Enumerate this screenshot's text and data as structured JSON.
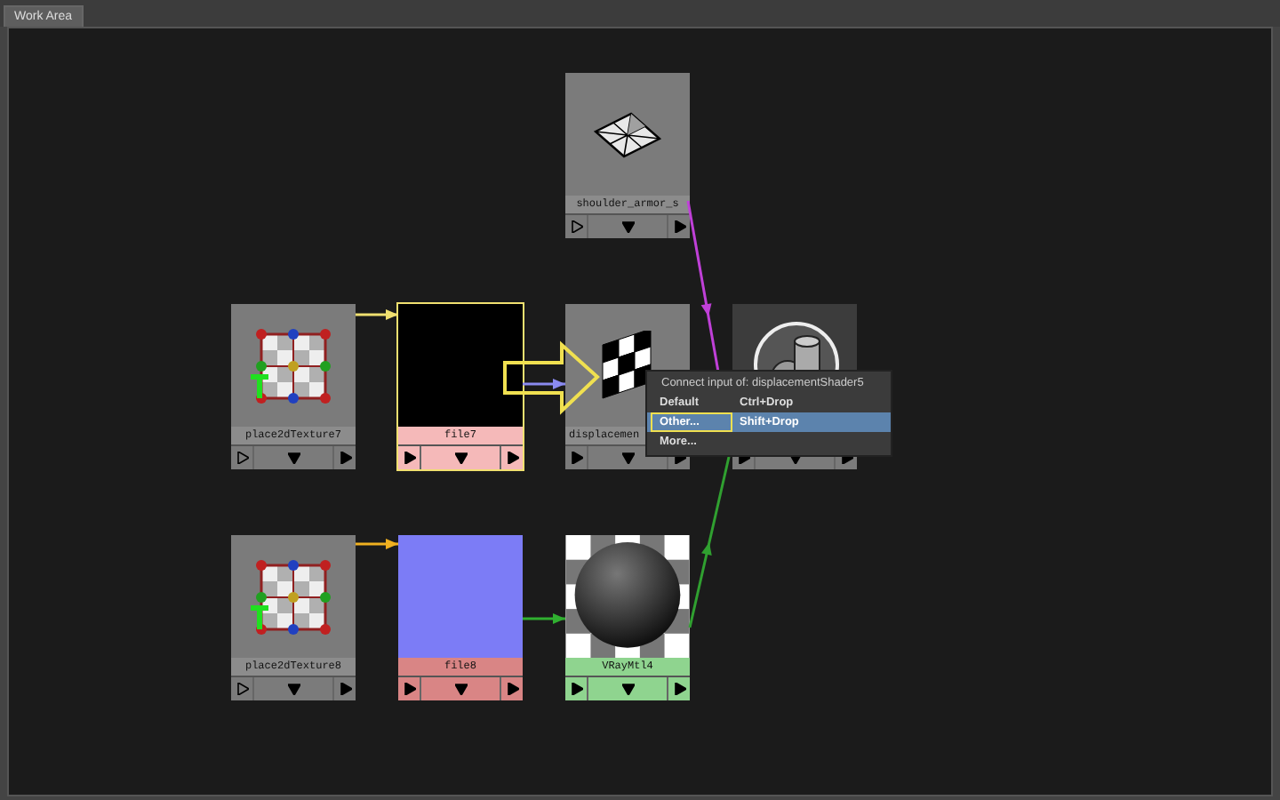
{
  "tabs": [
    {
      "label": "Work Area",
      "selected": true
    }
  ],
  "nodes": [
    {
      "kind": "geometry",
      "label": "shoulder_armor_s",
      "color": "#8c8c8c",
      "selected": false
    },
    {
      "kind": "placement",
      "label": "place2dTexture7",
      "color": "#8c8c8c",
      "selected": false
    },
    {
      "kind": "file",
      "label": "file7",
      "color": "#f5b9b9",
      "swatch": {
        "color": "#000000"
      },
      "selected": true
    },
    {
      "kind": "displacement",
      "label": "displacemen",
      "color": "#8c8c8c",
      "selected": false
    },
    {
      "kind": "shading-group",
      "selected": false
    },
    {
      "kind": "placement",
      "label": "place2dTexture8",
      "color": "#8c8c8c",
      "selected": false
    },
    {
      "kind": "file",
      "label": "file8",
      "color": "#d98585",
      "swatch": {
        "color": "#7c7cf6"
      },
      "selected": false
    },
    {
      "kind": "material",
      "label": "VRayMtl4",
      "color": "#8fd48f",
      "selected": false
    }
  ],
  "connections": [
    {
      "color": "#f0e070"
    },
    {
      "color": "#f0b020"
    },
    {
      "color": "#30b030"
    },
    {
      "color": "#8a8af0"
    },
    {
      "color": "#c040d8"
    },
    {
      "color": "#30a030"
    }
  ],
  "menu": {
    "title": "Connect input of: displacementShader5",
    "items": [
      {
        "label": "Default",
        "shortcut": "Ctrl+Drop",
        "selected": false,
        "outlined": false
      },
      {
        "label": "Other...",
        "shortcut": "Shift+Drop",
        "selected": true,
        "outlined": true
      },
      {
        "label": "More...",
        "selected": false,
        "outlined": false
      }
    ]
  }
}
